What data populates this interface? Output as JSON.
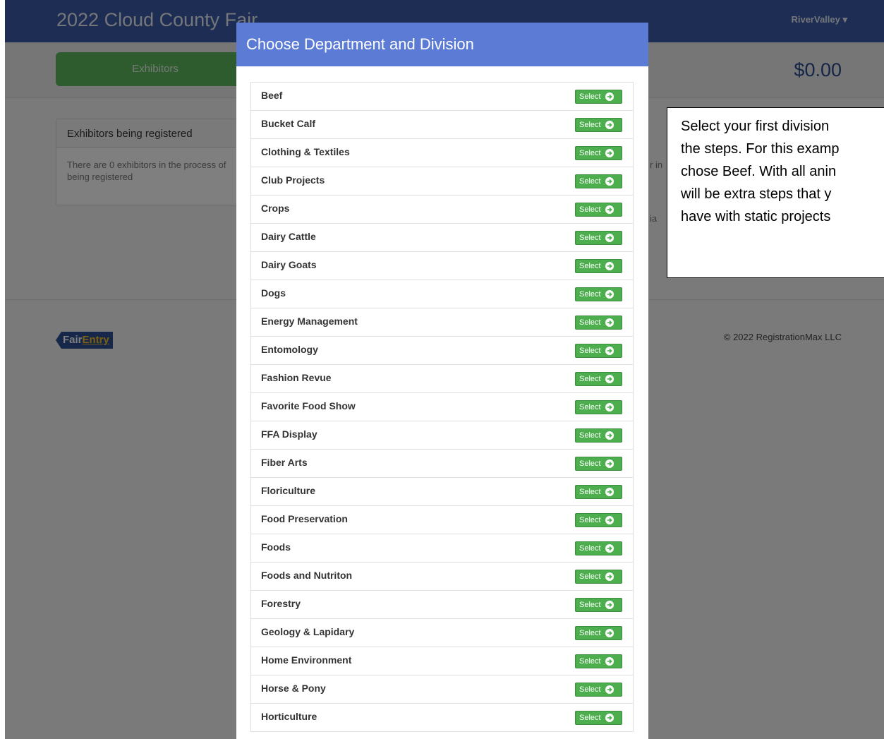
{
  "header": {
    "title": "2022 Cloud County Fair",
    "user_menu": "RiverValley ▾"
  },
  "subbar": {
    "exhibitors_label": "Exhibitors",
    "total": "$0.00"
  },
  "panel": {
    "title": "Exhibitors being registered",
    "body": "There are 0 exhibitors in the process of being registered",
    "frag_right": "r in",
    "frag_low": "ia"
  },
  "footer": {
    "logo_part1": "Fair",
    "logo_part2": "Entry",
    "copyright": "© 2022 RegistrationMax LLC"
  },
  "modal": {
    "title": "Choose Department and Division",
    "select_label": "Select",
    "departments": [
      "Beef",
      "Bucket Calf",
      "Clothing & Textiles",
      "Club Projects",
      "Crops",
      "Dairy Cattle",
      "Dairy Goats",
      "Dogs",
      "Energy Management",
      "Entomology",
      "Fashion Revue",
      "Favorite Food Show",
      "FFA Display",
      "Fiber Arts",
      "Floriculture",
      "Food Preservation",
      "Foods",
      "Foods and Nutriton",
      "Forestry",
      "Geology & Lapidary",
      "Home Environment",
      "Horse & Pony",
      "Horticulture"
    ]
  },
  "callout": {
    "lines": [
      "Select your first division",
      "the steps. For this examp",
      "chose Beef. With all anin",
      "will be extra steps that y",
      "have with static projects"
    ]
  }
}
